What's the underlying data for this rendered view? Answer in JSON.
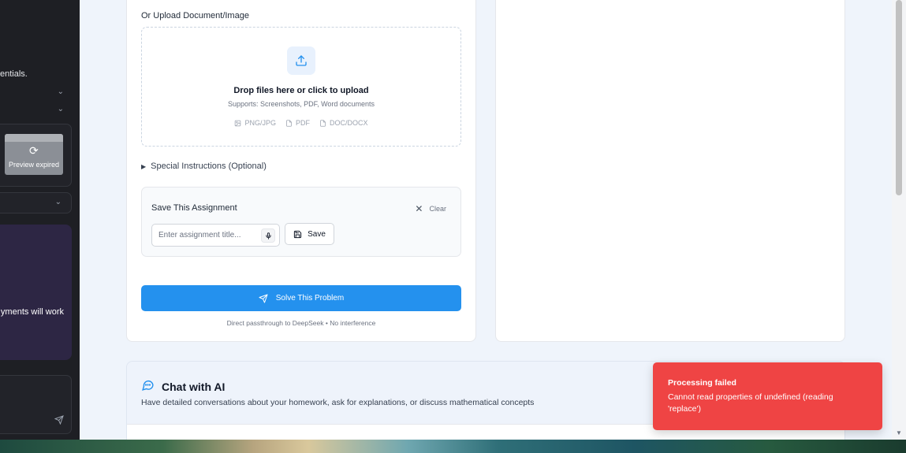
{
  "left_panel": {
    "partial_text_1": "entials.",
    "preview_expired": "Preview expired",
    "partial_text_2": "yments will work"
  },
  "upload": {
    "heading": "Or Upload Document/Image",
    "drop_title": "Drop files here or click to upload",
    "drop_subtitle": "Supports: Screenshots, PDF, Word documents",
    "file_types": [
      "PNG/JPG",
      "PDF",
      "DOC/DOCX"
    ]
  },
  "special_instructions": {
    "label": "Special Instructions (Optional)"
  },
  "save_assignment": {
    "title": "Save This Assignment",
    "clear_label": "Clear",
    "input_placeholder": "Enter assignment title...",
    "input_value": "",
    "save_label": "Save"
  },
  "solve": {
    "button_label": "Solve This Problem",
    "note": "Direct passthrough to DeepSeek • No interference"
  },
  "chat": {
    "title": "Chat with AI",
    "description": "Have detailed conversations about your homework, ask for explanations, or discuss mathematical concepts"
  },
  "toast": {
    "title": "Processing failed",
    "message": "Cannot read properties of undefined (reading 'replace')"
  },
  "colors": {
    "accent": "#2491ee",
    "error": "#ef4444",
    "page_bg": "#eff4fb"
  },
  "icons": {
    "upload": "upload-icon",
    "mic": "microphone-icon",
    "save": "floppy-disk-icon",
    "send": "paper-plane-icon",
    "chat": "chat-bubble-icon",
    "close": "close-icon"
  }
}
